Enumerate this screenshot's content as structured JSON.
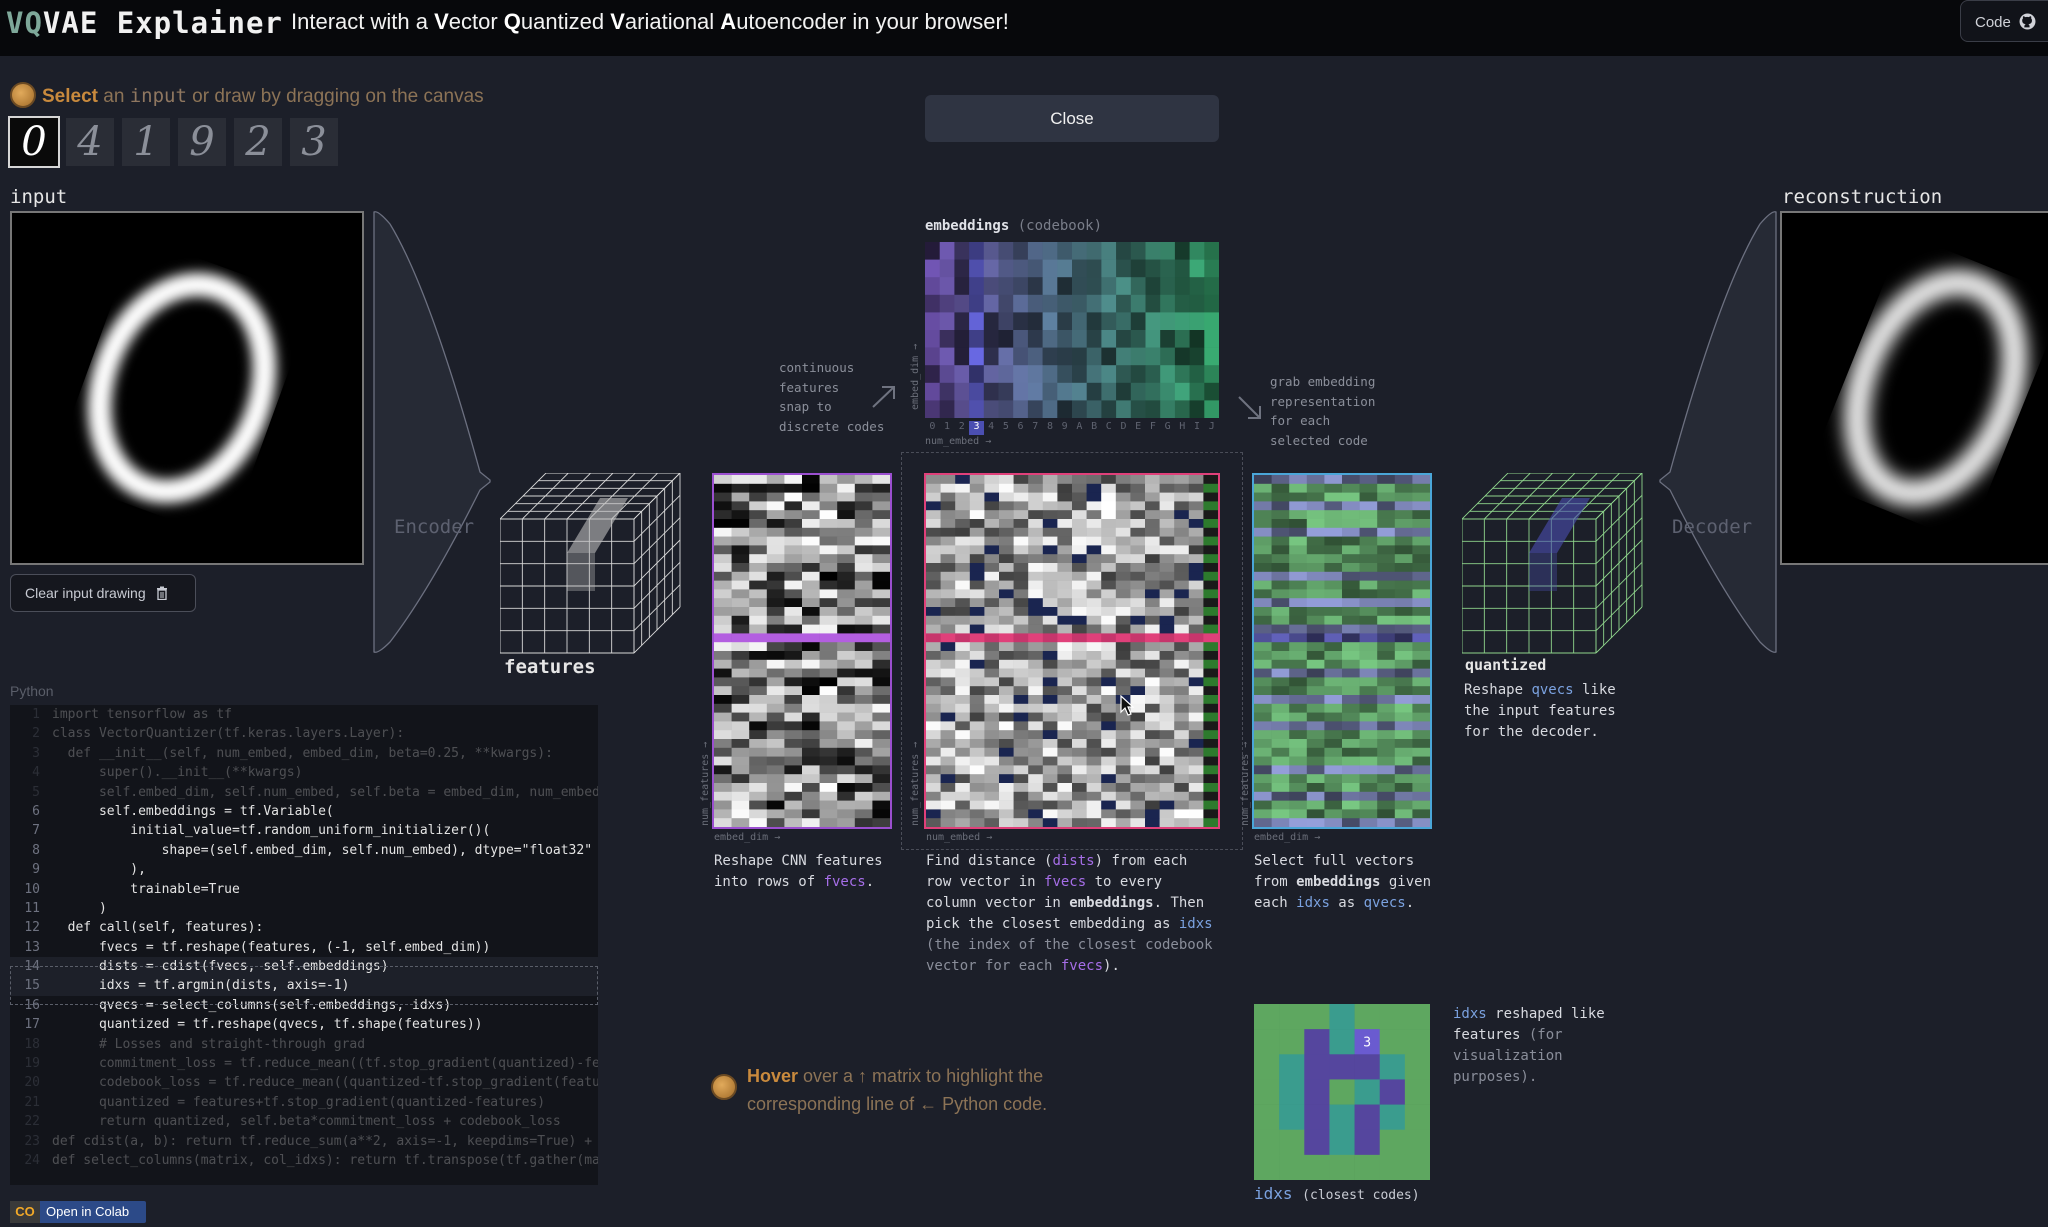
{
  "header": {
    "logo_vq": "VQ",
    "logo_rest": "VAE Explainer",
    "tagline_parts": [
      {
        "t": "Interact with a ",
        "b": false
      },
      {
        "t": "V",
        "b": true
      },
      {
        "t": "ector ",
        "b": false
      },
      {
        "t": "Q",
        "b": true
      },
      {
        "t": "uantized ",
        "b": false
      },
      {
        "t": "V",
        "b": true
      },
      {
        "t": "ariational ",
        "b": false
      },
      {
        "t": "A",
        "b": true
      },
      {
        "t": "utoencoder in your browser!",
        "b": false
      }
    ],
    "code_button": "Code"
  },
  "select_hint": {
    "bold": "Select",
    "a": " an ",
    "code": "input",
    "b": " or draw by dragging on the canvas"
  },
  "digits": [
    "0",
    "4",
    "1",
    "9",
    "2",
    "3"
  ],
  "selected_digit_index": 0,
  "labels": {
    "input": "input",
    "reconstruction": "reconstruction",
    "encoder": "Encoder",
    "decoder": "Decoder",
    "features": "features",
    "quantized": "quantized",
    "python": "Python"
  },
  "buttons": {
    "clear_input": "Clear input drawing",
    "close": "Close",
    "open_colab": "Open in Colab",
    "colab_logo": "CO"
  },
  "embeddings": {
    "title": "embeddings",
    "subtitle": "(codebook)",
    "axis_x": "num_embed →",
    "axis_y": "embed_dim →",
    "col_ticks": [
      "0",
      "1",
      "2",
      "3",
      "4",
      "5",
      "6",
      "7",
      "8",
      "9",
      "A",
      "B",
      "C",
      "D",
      "E",
      "F",
      "G",
      "H",
      "I",
      "J"
    ],
    "selected_col": 3
  },
  "annotations": {
    "snap": [
      "continuous",
      "features",
      "snap to",
      "discrete codes"
    ],
    "grab": [
      "grab embedding",
      "representation",
      "for each",
      "selected code"
    ]
  },
  "matrices": {
    "fvecs_axis_x": "embed_dim →",
    "fvecs_axis_y": "num_features →",
    "dists_axis_x": "num_embed →",
    "dists_axis_y": "num_features →",
    "qvecs_axis_x": "embed_dim →",
    "qvecs_axis_y": "num_features →"
  },
  "descriptions": {
    "fvecs": [
      "Reshape CNN features",
      "into rows of ",
      "fvecs",
      "."
    ],
    "dists": {
      "l1a": "Find distance (",
      "l1b": "dists",
      "l1c": ") from each",
      "l2a": "row vector in ",
      "l2b": "fvecs",
      "l2c": " to every",
      "l3a": "column vector in ",
      "l3b": "embeddings",
      "l3c": ". Then",
      "l4a": "pick the closest embedding as ",
      "l4b": "idxs",
      "l5": "(the index of the closest codebook",
      "l6a": "vector for each ",
      "l6b": "fvecs",
      "l6c": ")."
    },
    "qvecs": {
      "l1": "Select full vectors",
      "l2a": "from ",
      "l2b": "embeddings",
      "l2c": " given",
      "l3a": "each ",
      "l3b": "idxs",
      "l3c": " as ",
      "l3d": "qvecs",
      "l3e": "."
    },
    "quantized": {
      "l1a": "Reshape ",
      "l1b": "qvecs",
      "l1c": " like",
      "l2": "the input features",
      "l3": "for the decoder."
    },
    "idxs_note": {
      "l1a": "idxs",
      "l1b": " reshaped like",
      "l2a": "features",
      "l2b": " (for",
      "l3": "visualization",
      "l4": "purposes)."
    }
  },
  "idxs_grid": {
    "title": "idxs",
    "subtitle": "(closest codes)",
    "highlight_value": "3"
  },
  "hover_hint": {
    "bold": "Hover",
    "a": " over a ↑ matrix to highlight the corresponding line of ← Python code."
  },
  "code_lines": [
    {
      "n": "1",
      "t": "import tensorflow as tf",
      "faded": true
    },
    {
      "n": "2",
      "t": "class VectorQuantizer(tf.keras.layers.Layer):",
      "faded": true
    },
    {
      "n": "3",
      "t": "  def __init__(self, num_embed, embed_dim, beta=0.25, **kwargs):",
      "faded": true
    },
    {
      "n": "4",
      "t": "      super().__init__(**kwargs)",
      "faded": true
    },
    {
      "n": "5",
      "t": "      self.embed_dim, self.num_embed, self.beta = embed_dim, num_embed",
      "faded": true
    },
    {
      "n": "6",
      "t": "      self.embeddings = tf.Variable(",
      "faded": false
    },
    {
      "n": "7",
      "t": "          initial_value=tf.random_uniform_initializer()(",
      "faded": false
    },
    {
      "n": "8",
      "t": "              shape=(self.embed_dim, self.num_embed), dtype=\"float32\"",
      "faded": false
    },
    {
      "n": "9",
      "t": "          ),",
      "faded": false
    },
    {
      "n": "10",
      "t": "          trainable=True",
      "faded": false
    },
    {
      "n": "11",
      "t": "      )",
      "faded": false
    },
    {
      "n": "12",
      "t": "  def call(self, features):",
      "faded": false
    },
    {
      "n": "13",
      "t": "      fvecs = tf.reshape(features, (-1, self.embed_dim))",
      "faded": false
    },
    {
      "n": "14",
      "t": "      dists = cdist(fvecs, self.embeddings)",
      "faded": false
    },
    {
      "n": "15",
      "t": "      idxs = tf.argmin(dists, axis=-1)",
      "faded": false
    },
    {
      "n": "16",
      "t": "      qvecs = select_columns(self.embeddings, idxs)",
      "faded": false
    },
    {
      "n": "17",
      "t": "      quantized = tf.reshape(qvecs, tf.shape(features))",
      "faded": false
    },
    {
      "n": "18",
      "t": "      # Losses and straight-through grad",
      "faded": true
    },
    {
      "n": "19",
      "t": "      commitment_loss = tf.reduce_mean((tf.stop_gradient(quantized)-fe",
      "faded": true
    },
    {
      "n": "20",
      "t": "      codebook_loss = tf.reduce_mean((quantized-tf.stop_gradient(featu",
      "faded": true
    },
    {
      "n": "21",
      "t": "      quantized = features+tf.stop_gradient(quantized-features)",
      "faded": true
    },
    {
      "n": "22",
      "t": "      return quantized, self.beta*commitment_loss + codebook_loss",
      "faded": true
    },
    {
      "n": "23",
      "t": "def cdist(a, b): return tf.reduce_sum(a**2, axis=-1, keepdims=True) +",
      "faded": true
    },
    {
      "n": "24",
      "t": "def select_columns(matrix, col_idxs): return tf.transpose(tf.gather(ma",
      "faded": true
    }
  ],
  "highlighted_code_lines": [
    "14",
    "15"
  ],
  "colors": {
    "fvecs_border": "#9b4fd0",
    "dists_border": "#e0407a",
    "qvecs_border": "#4aa6d8",
    "accent_orange": "#c98a3d",
    "code_purple": "#a66ee8",
    "code_blue": "#7ba2e0"
  },
  "icons": {
    "github": "github-icon",
    "trash": "trash-icon",
    "hint": "coin-icon",
    "cursor": "mouse-cursor-icon"
  }
}
